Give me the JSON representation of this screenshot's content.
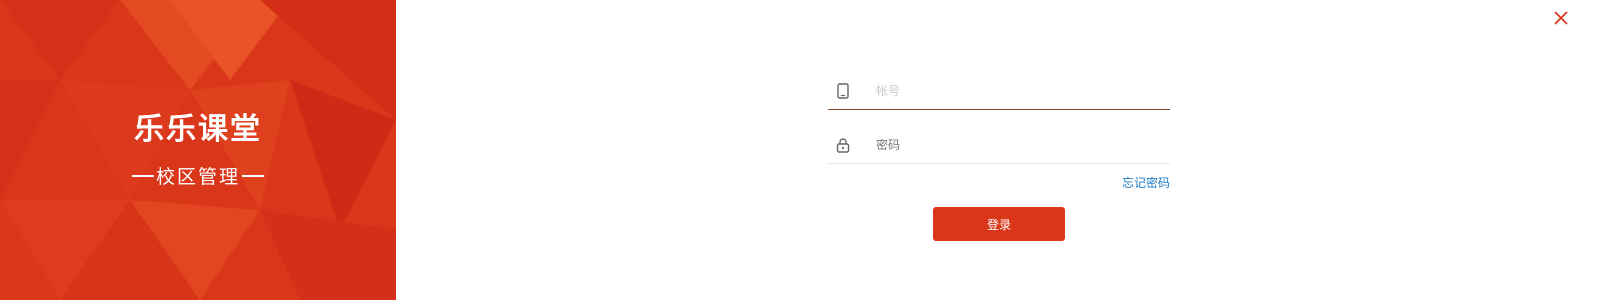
{
  "brand": {
    "name": "乐乐课堂",
    "subtitle": "校区管理"
  },
  "form": {
    "account_placeholder": "帐号",
    "password_placeholder": "密码",
    "forgot_label": "忘记密码",
    "login_label": "登录"
  },
  "icons": {
    "account": "phone-icon",
    "password": "lock-icon",
    "close": "close-icon"
  },
  "colors": {
    "brand_red": "#d9361a",
    "link_blue": "#1f7dc5",
    "close_orange": "#d9361a"
  }
}
